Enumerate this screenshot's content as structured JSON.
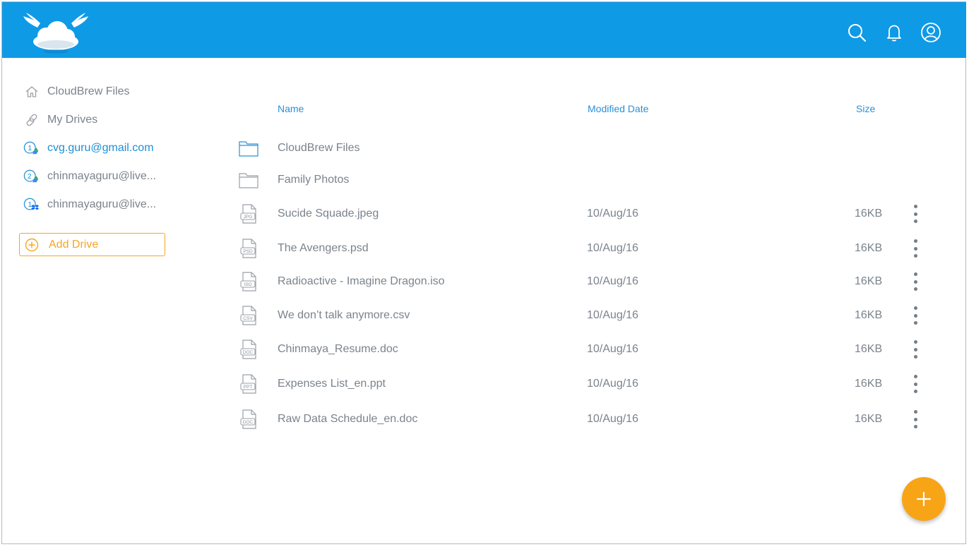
{
  "header": {
    "logo_icon": "winged-cloud-logo",
    "actions": [
      {
        "name": "search",
        "icon": "search-icon"
      },
      {
        "name": "notifications",
        "icon": "bell-icon"
      },
      {
        "name": "profile",
        "icon": "user-icon"
      }
    ],
    "colors": {
      "header_bg": "#0f9ae6",
      "accent": "#f5a623",
      "link": "#1e8fd6"
    }
  },
  "sidebar": {
    "items": [
      {
        "label": "CloudBrew Files",
        "icon": "home-icon"
      },
      {
        "label": "My Drives",
        "icon": "link-icon"
      },
      {
        "label": "cvg.guru@gmail.com",
        "icon": "google-drive-1-icon",
        "badge": "1",
        "active": true
      },
      {
        "label": "chinmayaguru@live...",
        "icon": "google-drive-2-icon",
        "badge": "2"
      },
      {
        "label": "chinmayaguru@live...",
        "icon": "dropbox-1-icon",
        "badge": "1"
      }
    ],
    "add_drive_label": "Add Drive"
  },
  "table": {
    "columns": {
      "name": "Name",
      "modified": "Modified Date",
      "size": "Size"
    },
    "rows": [
      {
        "name": "CloudBrew Files",
        "type": "folder",
        "modified": "",
        "size": ""
      },
      {
        "name": "Family Photos",
        "type": "folder",
        "modified": "",
        "size": ""
      },
      {
        "name": "Sucide Squade.jpeg",
        "type": "JPG",
        "modified": "10/Aug/16",
        "size": "16KB"
      },
      {
        "name": "The Avengers.psd",
        "type": "PSD",
        "modified": "10/Aug/16",
        "size": "16KB"
      },
      {
        "name": "Radioactive - Imagine Dragon.iso",
        "type": "ISO",
        "modified": "10/Aug/16",
        "size": "16KB"
      },
      {
        "name": "We don’t talk anymore.csv",
        "type": "CSV",
        "modified": "10/Aug/16",
        "size": "16KB"
      },
      {
        "name": "Chinmaya_Resume.doc",
        "type": "DOC",
        "modified": "10/Aug/16",
        "size": "16KB"
      },
      {
        "name": "Expenses List_en.ppt",
        "type": "PPT",
        "modified": "10/Aug/16",
        "size": "16KB"
      },
      {
        "name": "Raw Data Schedule_en.doc",
        "type": "DOC",
        "modified": "10/Aug/16",
        "size": "16KB"
      }
    ]
  },
  "fab": {
    "icon": "plus-icon"
  }
}
